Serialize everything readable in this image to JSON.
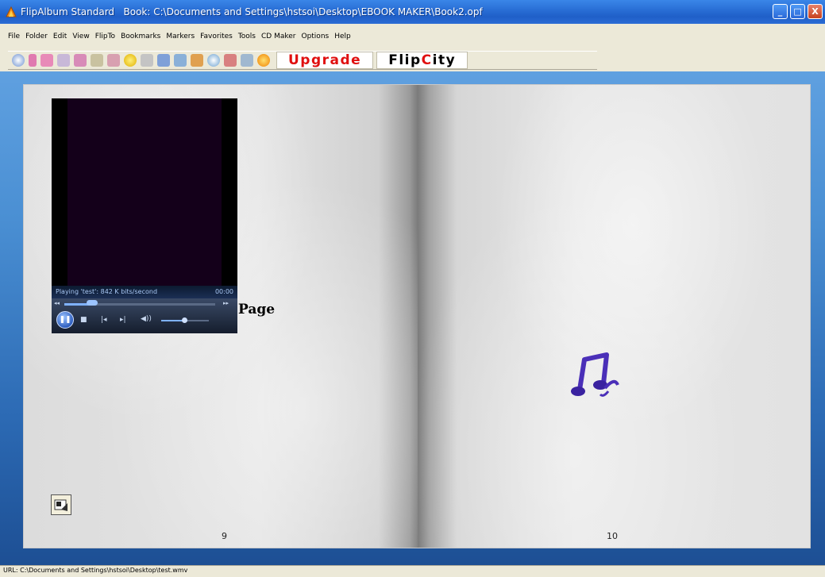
{
  "window": {
    "app_title": "FlipAlbum Standard",
    "book_label": "Book: C:\\Documents and Settings\\hstsoi\\Desktop\\EBOOK MAKER\\Book2.opf",
    "minimize": "_",
    "maximize": "□",
    "close": "X"
  },
  "menu": {
    "items": [
      "File",
      "Folder",
      "Edit",
      "View",
      "FlipTo",
      "Bookmarks",
      "Markers",
      "Favorites",
      "Tools",
      "CD Maker",
      "Options",
      "Help"
    ]
  },
  "toolbar": {
    "upgrade_label": "Upgrade",
    "flipcity_prefix": "Flip",
    "flipcity_c": "C",
    "flipcity_suffix": "ity"
  },
  "book": {
    "left_page_number": "9",
    "right_page_number": "10",
    "left_page_text": "Page"
  },
  "player": {
    "status_text": "Playing 'test': 842 K bits/second",
    "time": "00:00",
    "progress": 0.17,
    "volume": 0.55
  },
  "statusbar": {
    "url": "URL: C:\\Documents and Settings\\hstsoi\\Desktop\\test.wmv"
  }
}
